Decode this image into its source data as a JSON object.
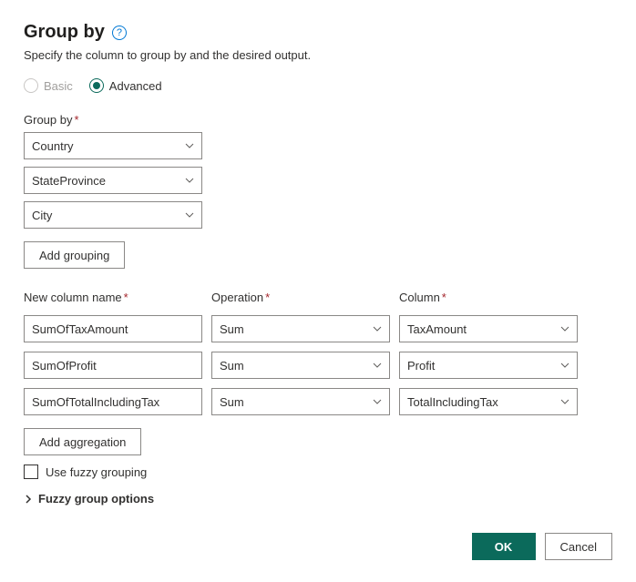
{
  "header": {
    "title": "Group by",
    "subtitle": "Specify the column to group by and the desired output."
  },
  "mode": {
    "basic_label": "Basic",
    "advanced_label": "Advanced",
    "selected": "Advanced"
  },
  "group_by": {
    "label": "Group by",
    "columns": [
      "Country",
      "StateProvince",
      "City"
    ],
    "add_button": "Add grouping"
  },
  "aggregations": {
    "headers": {
      "name": "New column name",
      "operation": "Operation",
      "column": "Column"
    },
    "rows": [
      {
        "name": "SumOfTaxAmount",
        "operation": "Sum",
        "column": "TaxAmount"
      },
      {
        "name": "SumOfProfit",
        "operation": "Sum",
        "column": "Profit"
      },
      {
        "name": "SumOfTotalIncludingTax",
        "operation": "Sum",
        "column": "TotalIncludingTax"
      }
    ],
    "add_button": "Add aggregation"
  },
  "fuzzy": {
    "checkbox_label": "Use fuzzy grouping",
    "options_label": "Fuzzy group options"
  },
  "footer": {
    "ok": "OK",
    "cancel": "Cancel"
  }
}
